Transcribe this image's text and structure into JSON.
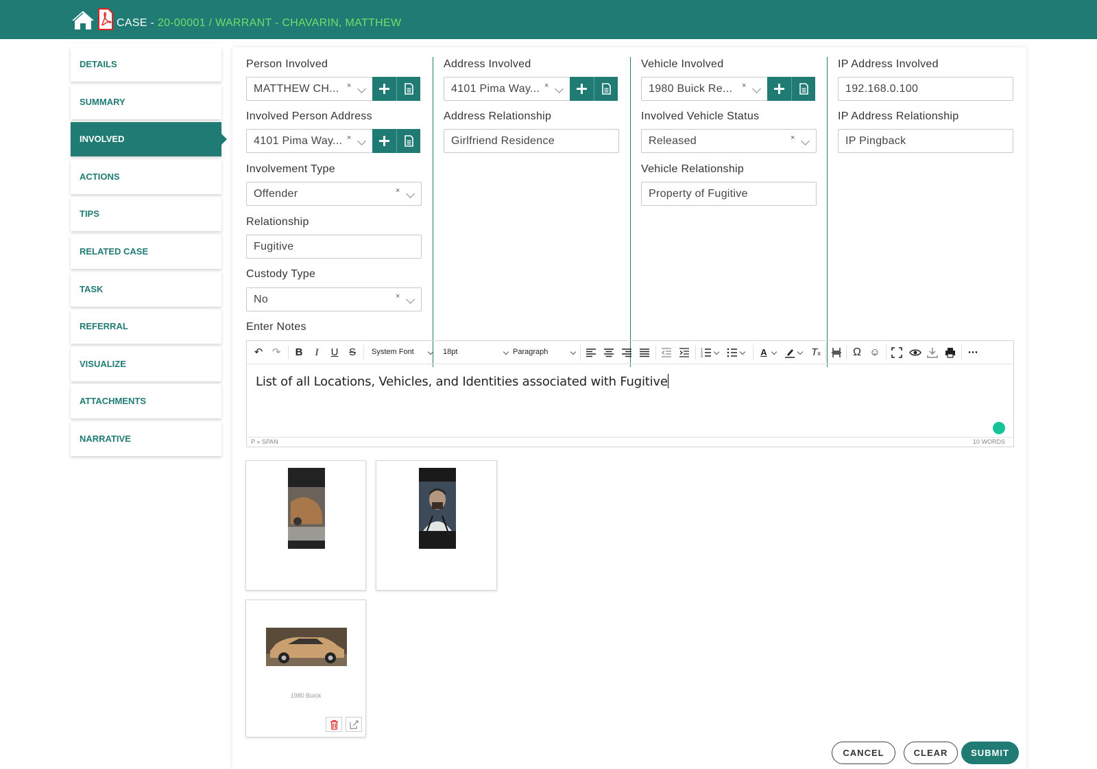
{
  "header": {
    "prefix": "CASE - ",
    "case_ref": "20-00001 / WARRANT - CHAVARIN, MATTHEW"
  },
  "sidebar": {
    "items": [
      {
        "label": "DETAILS",
        "active": false
      },
      {
        "label": "SUMMARY",
        "active": false
      },
      {
        "label": "INVOLVED",
        "active": true
      },
      {
        "label": "ACTIONS",
        "active": false
      },
      {
        "label": "TIPS",
        "active": false
      },
      {
        "label": "RELATED CASE",
        "active": false
      },
      {
        "label": "TASK",
        "active": false
      },
      {
        "label": "REFERRAL",
        "active": false
      },
      {
        "label": "VISUALIZE",
        "active": false
      },
      {
        "label": "ATTACHMENTS",
        "active": false
      },
      {
        "label": "NARRATIVE",
        "active": false
      }
    ]
  },
  "person": {
    "label": "Person Involved",
    "value": "MATTHEW CH...",
    "address_label": "Involved Person Address",
    "address_value": "4101 Pima Way...",
    "involvement_label": "Involvement Type",
    "involvement_value": "Offender",
    "relationship_label": "Relationship",
    "relationship_value": "Fugitive",
    "custody_label": "Custody Type",
    "custody_value": "No"
  },
  "address": {
    "label": "Address Involved",
    "value": "4101 Pima Way...",
    "relationship_label": "Address Relationship",
    "relationship_value": "Girlfriend Residence"
  },
  "vehicle": {
    "label": "Vehicle Involved",
    "value": "1980 Buick Re...",
    "status_label": "Involved Vehicle Status",
    "status_value": "Released",
    "relationship_label": "Vehicle Relationship",
    "relationship_value": "Property of Fugitive"
  },
  "ip": {
    "label": "IP Address Involved",
    "value": "192.168.0.100",
    "relationship_label": "IP Address Relationship",
    "relationship_value": "IP Pingback"
  },
  "notes": {
    "label": "Enter Notes",
    "font": "System Font",
    "size": "18pt",
    "block": "Paragraph",
    "content": "List of all Locations, Vehicles, and Identities associated with Fugitive",
    "path": "P » SPAN",
    "word_count": "10 WORDS"
  },
  "attachments": {
    "items": [
      {
        "caption": ""
      },
      {
        "caption": ""
      },
      {
        "caption": "1980 Buick"
      }
    ]
  },
  "actions": {
    "cancel": "CANCEL",
    "clear": "CLEAR",
    "submit": "SUBMIT"
  },
  "colors": {
    "brand": "#1f7b74",
    "highlight": "#6fe06a",
    "pdf_red": "#e02424"
  }
}
